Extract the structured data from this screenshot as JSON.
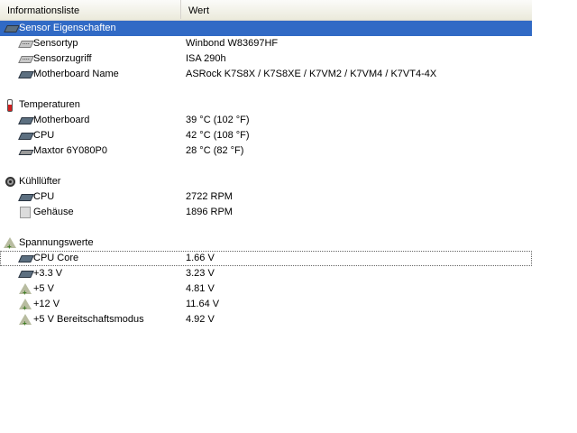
{
  "header": {
    "col1": "Informationsliste",
    "col2": "Wert"
  },
  "sensor": {
    "title": "Sensor Eigenschaften",
    "rows": [
      {
        "name": "Sensortyp",
        "value": "Winbond W83697HF"
      },
      {
        "name": "Sensorzugriff",
        "value": "ISA 290h"
      },
      {
        "name": "Motherboard Name",
        "value": "ASRock K7S8X / K7S8XE / K7VM2 / K7VM4 / K7VT4-4X"
      }
    ]
  },
  "temperatures": {
    "title": "Temperaturen",
    "rows": [
      {
        "name": "Motherboard",
        "value": "39 °C  (102 °F)"
      },
      {
        "name": "CPU",
        "value": "42 °C  (108 °F)"
      },
      {
        "name": "Maxtor 6Y080P0",
        "value": "28 °C  (82 °F)"
      }
    ]
  },
  "fans": {
    "title": "Kühllüfter",
    "rows": [
      {
        "name": "CPU",
        "value": "2722 RPM"
      },
      {
        "name": "Gehäuse",
        "value": "1896 RPM"
      }
    ]
  },
  "voltages": {
    "title": "Spannungswerte",
    "rows": [
      {
        "name": "CPU Core",
        "value": "1.66 V"
      },
      {
        "name": "+3.3 V",
        "value": "3.23 V"
      },
      {
        "name": "+5 V",
        "value": "4.81 V"
      },
      {
        "name": "+12 V",
        "value": "11.64 V"
      },
      {
        "name": "+5 V Bereitschaftsmodus",
        "value": "4.92 V"
      }
    ]
  }
}
